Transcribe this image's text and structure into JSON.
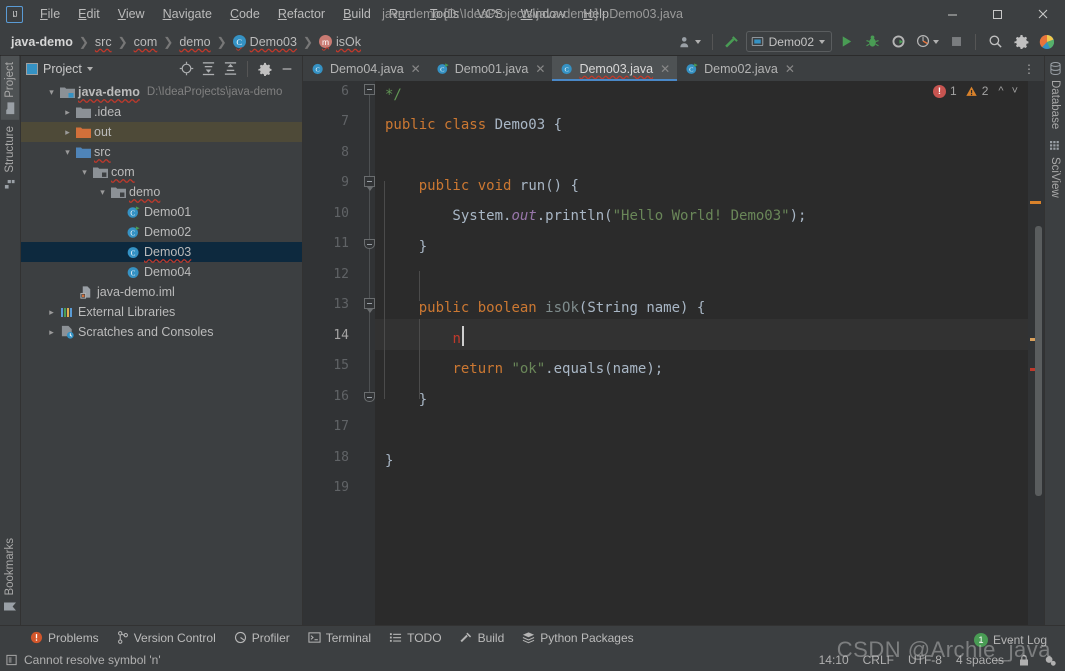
{
  "window": {
    "title": "java-demo [D:\\IdeaProjects\\java-demo] - Demo03.java",
    "minimize": "—",
    "maximize": "☐",
    "close": "✕",
    "logo": "IJ"
  },
  "menu": [
    "File",
    "Edit",
    "View",
    "Navigate",
    "Code",
    "Refactor",
    "Build",
    "Run",
    "Tools",
    "VCS",
    "Window",
    "Help"
  ],
  "breadcrumb": [
    {
      "label": "java-demo",
      "bold": true,
      "icon": "none"
    },
    {
      "label": "src",
      "bold": false,
      "icon": "none"
    },
    {
      "label": "com",
      "bold": false,
      "icon": "none"
    },
    {
      "label": "demo",
      "bold": false,
      "icon": "none"
    },
    {
      "label": "Demo03",
      "bold": false,
      "icon": "class-icon"
    },
    {
      "label": "isOk",
      "bold": false,
      "icon": "method-icon"
    }
  ],
  "toolbar": {
    "run_config": "Demo02",
    "icons": [
      "user-icon",
      "build-hammer-icon",
      "run-icon",
      "debug-icon",
      "run-coverage-icon",
      "profile-icon",
      "stop-icon",
      "search-icon",
      "settings-gear-icon",
      "updates-icon"
    ]
  },
  "project_panel": {
    "title": "Project",
    "tools": [
      "locate-icon",
      "expand-all-icon",
      "collapse-all-icon",
      "settings-gear-icon",
      "hide-icon"
    ],
    "tree": [
      {
        "label": "java-demo",
        "path": "D:\\IdeaProjects\\java-demo",
        "depth": 0,
        "arrow": "down",
        "icon": "module-folder",
        "bold": true,
        "wavy": true,
        "state": "normal"
      },
      {
        "label": ".idea",
        "path": "",
        "depth": 1,
        "arrow": "right",
        "icon": "folder-grey",
        "bold": false,
        "wavy": false,
        "state": "normal"
      },
      {
        "label": "out",
        "path": "",
        "depth": 1,
        "arrow": "right",
        "icon": "folder-orange",
        "bold": false,
        "wavy": false,
        "state": "highlight"
      },
      {
        "label": "src",
        "path": "",
        "depth": 1,
        "arrow": "down",
        "icon": "folder-blue",
        "bold": false,
        "wavy": true,
        "state": "normal"
      },
      {
        "label": "com",
        "path": "",
        "depth": 2,
        "arrow": "down",
        "icon": "package-icon",
        "bold": false,
        "wavy": true,
        "state": "normal"
      },
      {
        "label": "demo",
        "path": "",
        "depth": 3,
        "arrow": "down",
        "icon": "package-icon",
        "bold": false,
        "wavy": true,
        "state": "normal"
      },
      {
        "label": "Demo01",
        "path": "",
        "depth": 4,
        "arrow": "none",
        "icon": "class-runnable-icon",
        "bold": false,
        "wavy": false,
        "state": "normal"
      },
      {
        "label": "Demo02",
        "path": "",
        "depth": 4,
        "arrow": "none",
        "icon": "class-runnable-icon",
        "bold": false,
        "wavy": false,
        "state": "normal"
      },
      {
        "label": "Demo03",
        "path": "",
        "depth": 4,
        "arrow": "none",
        "icon": "class-icon",
        "bold": false,
        "wavy": true,
        "state": "selected"
      },
      {
        "label": "Demo04",
        "path": "",
        "depth": 4,
        "arrow": "none",
        "icon": "class-icon",
        "bold": false,
        "wavy": false,
        "state": "normal"
      },
      {
        "label": "java-demo.iml",
        "path": "",
        "depth": 2,
        "arrow": "none",
        "icon": "iml-icon",
        "bold": false,
        "wavy": false,
        "state": "normal"
      },
      {
        "label": "External Libraries",
        "path": "",
        "depth": 0,
        "arrow": "right",
        "icon": "libraries-icon",
        "bold": false,
        "wavy": false,
        "state": "normal"
      },
      {
        "label": "Scratches and Consoles",
        "path": "",
        "depth": 0,
        "arrow": "right",
        "icon": "scratches-icon",
        "bold": false,
        "wavy": false,
        "state": "normal"
      }
    ]
  },
  "left_stripe": [
    {
      "label": "Project",
      "icon": "project-folder-icon",
      "selected": true
    },
    {
      "label": "Structure",
      "icon": "structure-icon",
      "selected": false
    },
    {
      "label": "Bookmarks",
      "icon": "bookmark-icon",
      "selected": false
    }
  ],
  "right_stripe": [
    {
      "label": "Database",
      "icon": "database-icon",
      "selected": false
    },
    {
      "label": "SciView",
      "icon": "sciview-grid-icon",
      "selected": false
    }
  ],
  "tabs": [
    {
      "label": "Demo04.java",
      "icon": "class-icon",
      "active": false
    },
    {
      "label": "Demo01.java",
      "icon": "class-runnable-icon",
      "active": false
    },
    {
      "label": "Demo03.java",
      "icon": "class-icon",
      "active": true
    },
    {
      "label": "Demo02.java",
      "icon": "class-runnable-icon",
      "active": false
    }
  ],
  "inspections": {
    "error_count": "1",
    "warning_count": "2",
    "up": "∧",
    "down": "∨"
  },
  "editor": {
    "first_line": 6,
    "current_line": 14,
    "line_numbers": [
      6,
      7,
      8,
      9,
      10,
      11,
      12,
      13,
      14,
      15,
      16,
      17,
      18,
      19
    ],
    "lines": [
      {
        "n": 6,
        "tokens": [
          {
            "t": "*/",
            "c": "cmt"
          }
        ],
        "indent": 1
      },
      {
        "n": 7,
        "tokens": [
          {
            "t": "public ",
            "c": "kw"
          },
          {
            "t": "class ",
            "c": "kw"
          },
          {
            "t": "Demo03 {",
            "c": "cls"
          }
        ],
        "indent": 0
      },
      {
        "n": 8,
        "tokens": [],
        "indent": 0
      },
      {
        "n": 9,
        "tokens": [
          {
            "t": "    ",
            "c": "pln"
          },
          {
            "t": "public ",
            "c": "kw"
          },
          {
            "t": "void ",
            "c": "kw"
          },
          {
            "t": "run",
            "c": "mth"
          },
          {
            "t": "() {",
            "c": "pln"
          }
        ],
        "indent": 0
      },
      {
        "n": 10,
        "tokens": [
          {
            "t": "        System.",
            "c": "pln"
          },
          {
            "t": "out",
            "c": "stat"
          },
          {
            "t": ".println(",
            "c": "pln"
          },
          {
            "t": "\"Hello World! Demo03\"",
            "c": "str"
          },
          {
            "t": ");",
            "c": "pln"
          }
        ],
        "indent": 0
      },
      {
        "n": 11,
        "tokens": [
          {
            "t": "    }",
            "c": "pln"
          }
        ],
        "indent": 0
      },
      {
        "n": 12,
        "tokens": [],
        "indent": 0
      },
      {
        "n": 13,
        "tokens": [
          {
            "t": "    ",
            "c": "pln"
          },
          {
            "t": "public ",
            "c": "kw"
          },
          {
            "t": "boolean ",
            "c": "kw"
          },
          {
            "t": "isOk",
            "c": "mth"
          },
          {
            "t": "(String name) {",
            "c": "pln"
          }
        ],
        "indent": 0
      },
      {
        "n": 14,
        "tokens": [
          {
            "t": "        ",
            "c": "pln"
          },
          {
            "t": "n",
            "c": "err"
          }
        ],
        "indent": 0
      },
      {
        "n": 15,
        "tokens": [
          {
            "t": "        ",
            "c": "pln"
          },
          {
            "t": "return ",
            "c": "kw"
          },
          {
            "t": "\"ok\"",
            "c": "str"
          },
          {
            "t": ".equals(name);",
            "c": "pln"
          }
        ],
        "indent": 0
      },
      {
        "n": 16,
        "tokens": [
          {
            "t": "    }",
            "c": "pln"
          }
        ],
        "indent": 0
      },
      {
        "n": 17,
        "tokens": [],
        "indent": 0
      },
      {
        "n": 18,
        "tokens": [
          {
            "t": "}",
            "c": "pln"
          }
        ],
        "indent": 0
      },
      {
        "n": 19,
        "tokens": [],
        "indent": 0
      }
    ]
  },
  "bottom_bar": [
    {
      "label": "Problems",
      "icon": "problems-icon"
    },
    {
      "label": "Version Control",
      "icon": "branch-icon"
    },
    {
      "label": "Profiler",
      "icon": "profiler-icon"
    },
    {
      "label": "Terminal",
      "icon": "terminal-icon"
    },
    {
      "label": "TODO",
      "icon": "todo-list-icon"
    },
    {
      "label": "Build",
      "icon": "build-hammer-icon"
    },
    {
      "label": "Python Packages",
      "icon": "packages-icon"
    }
  ],
  "status_bar": {
    "message": "Cannot resolve symbol 'n'",
    "message_icon": "inspection-icon",
    "position": "14:10",
    "line_separator": "CRLF",
    "encoding": "UTF-8",
    "indent": "4 spaces",
    "event_log": "Event Log",
    "event_badge": "1",
    "watermark": "CSDN @Archie_java"
  },
  "colors": {
    "accent_blue": "#4a88c7",
    "keyword_orange": "#cc7832",
    "string_green": "#6a8759",
    "comment_green": "#629755",
    "error_red": "#c0392b",
    "warning_orange": "#d9822b",
    "selection_blue": "#0d293e",
    "editor_bg": "#2b2b2b",
    "chrome_bg": "#3c3f41"
  }
}
